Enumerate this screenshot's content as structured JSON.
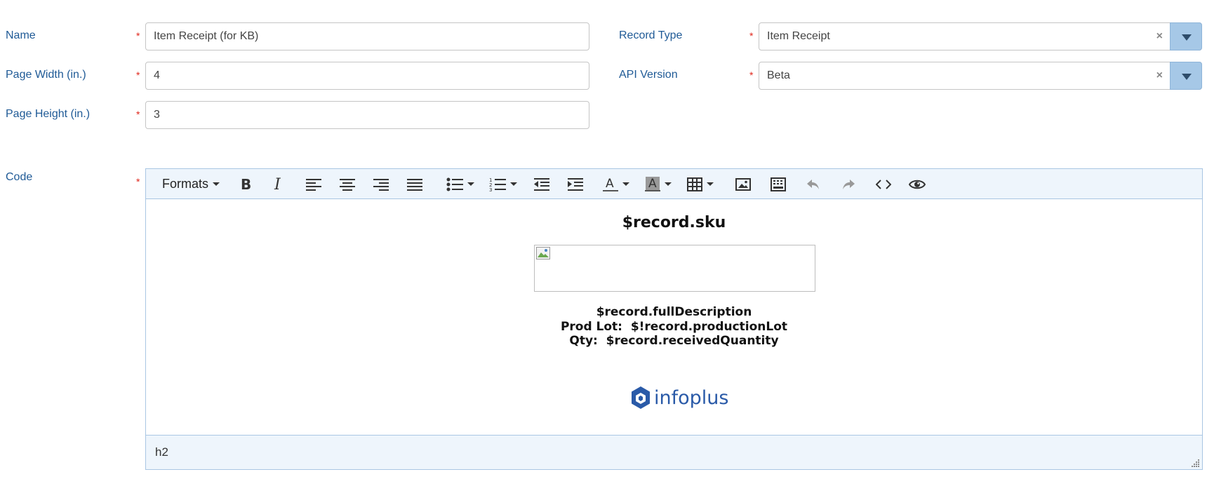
{
  "form": {
    "name": {
      "label": "Name",
      "required": "*",
      "value": "Item Receipt (for KB)"
    },
    "page_width": {
      "label": "Page Width (in.)",
      "required": "*",
      "value": "4"
    },
    "page_height": {
      "label": "Page Height (in.)",
      "required": "*",
      "value": "3"
    },
    "record_type": {
      "label": "Record Type",
      "required": "*",
      "value": "Item Receipt",
      "clear": "×"
    },
    "api_version": {
      "label": "API Version",
      "required": "*",
      "value": "Beta",
      "clear": "×"
    },
    "code": {
      "label": "Code",
      "required": "*"
    }
  },
  "editor": {
    "toolbar": {
      "formats_label": "Formats",
      "buttons": [
        "bold-icon",
        "italic-icon",
        "align-left-icon",
        "align-center-icon",
        "align-right-icon",
        "align-justify-icon",
        "bullet-list-icon",
        "numbered-list-icon",
        "outdent-icon",
        "indent-icon",
        "text-color-icon",
        "background-color-icon",
        "table-icon",
        "image-icon",
        "template-icon",
        "undo-icon",
        "redo-icon",
        "source-code-icon",
        "preview-icon"
      ]
    },
    "content": {
      "title": "$record.sku",
      "line1": "$record.fullDescription",
      "line2": "Prod Lot:  $!record.productionLot",
      "line3": "Qty:  $record.receivedQuantity",
      "logo_text": "infoplus"
    },
    "status_path": "h2"
  },
  "colors": {
    "label": "#1f5a96",
    "required": "#e0261b",
    "toolbar_bg": "#eef5fc",
    "dropdown_button": "#a6c8e7",
    "logo": "#2a5aa8"
  }
}
